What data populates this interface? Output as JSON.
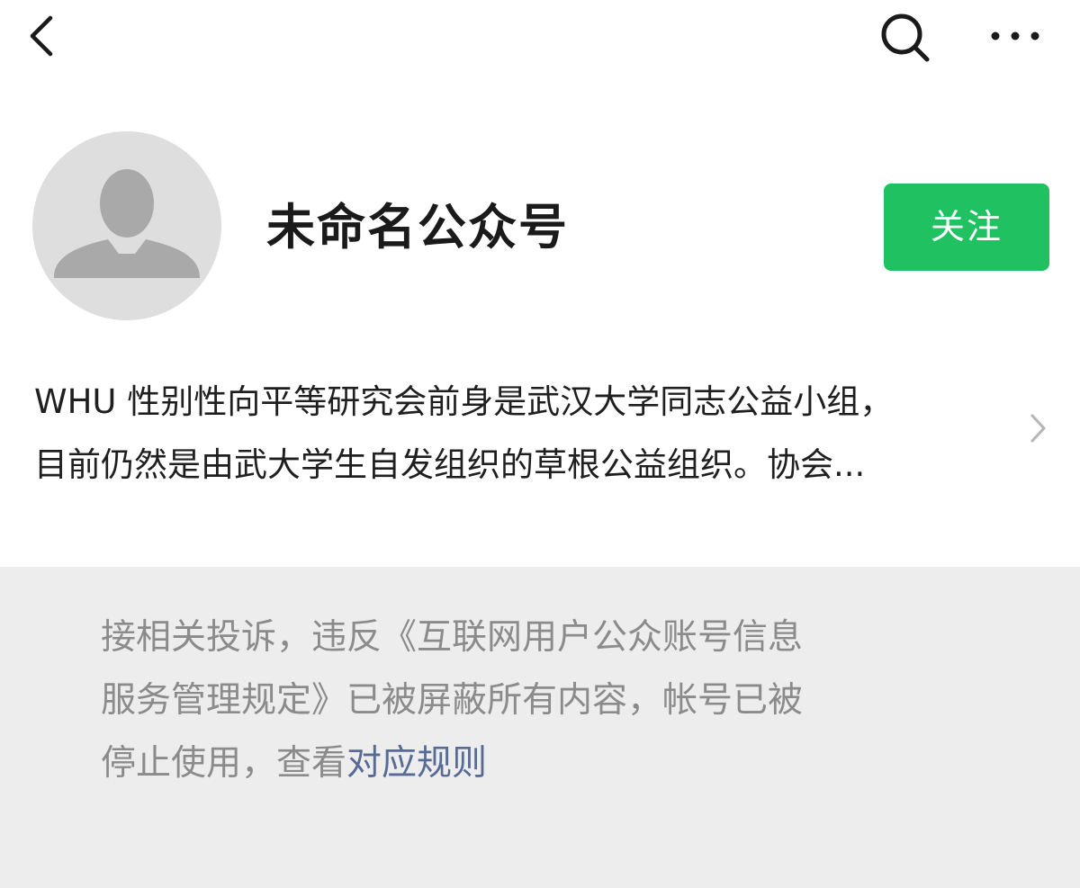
{
  "nav": {
    "back_icon": "chevron-left-icon",
    "search_icon": "search-icon",
    "more_icon": "more-horizontal-icon"
  },
  "profile": {
    "avatar_icon": "default-user-avatar",
    "name": "未命名公众号",
    "follow_label": "关注",
    "follow_color": "#1fc160",
    "intro_line1": "WHU 性别性向平等研究会前身是武汉大学同志公益小组，",
    "intro_line2": "目前仍然是由武大学生自发组织的草根公益组织。协会...",
    "intro_chevron_icon": "chevron-right-icon"
  },
  "notice": {
    "line1": "接相关投诉，违反《互联网用户公众账号信息",
    "line2": "服务管理规定》已被屏蔽所有内容，帐号已被",
    "line3_prefix": "停止使用，查看",
    "rules_link": "对应规则",
    "link_color": "#576b95"
  }
}
